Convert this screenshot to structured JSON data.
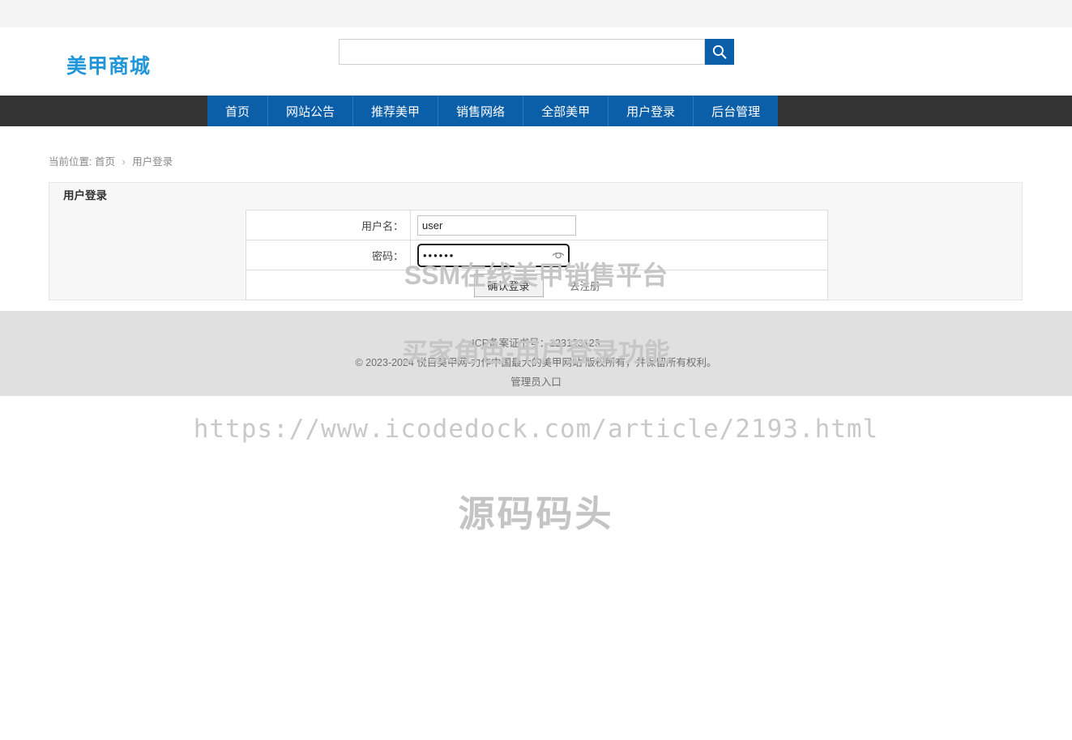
{
  "site": {
    "logo_text": "美甲商城",
    "logo_color": "#2196d8",
    "accent_color": "#0b5ea8",
    "nav_bar_color": "#333333"
  },
  "search": {
    "value": "",
    "placeholder": "",
    "icon": "search-icon"
  },
  "nav": {
    "items": [
      {
        "label": "首页"
      },
      {
        "label": "网站公告"
      },
      {
        "label": "推荐美甲"
      },
      {
        "label": "销售网络"
      },
      {
        "label": "全部美甲"
      },
      {
        "label": "用户登录"
      },
      {
        "label": "后台管理"
      }
    ]
  },
  "breadcrumb": {
    "prefix": "当前位置:",
    "home": "首页",
    "separator": "›",
    "current": "用户登录"
  },
  "panel": {
    "title": "用户登录"
  },
  "form": {
    "username_label": "用户名：",
    "username_value": "user",
    "username_placeholder": "",
    "password_label": "密码：",
    "password_value": "••••••",
    "password_masked_chars": 6,
    "password_placeholder": "",
    "password_reveal_icon": "eye-icon",
    "submit_label": "确认登录",
    "register_label": "去注册"
  },
  "footer": {
    "icp": "ICP备案证书号：123123123",
    "copyright": "© 2023-2024 悦目美甲网-力作中国最大的美甲网站 版权所有，并保留所有权利。",
    "admin_entry": "管理员入口"
  },
  "watermarks": {
    "line1": "SSM在线美甲销售平台",
    "line2": "买家角色-用户登录功能",
    "url": "https://www.icodedock.com/article/2193.html",
    "brand": "源码码头"
  }
}
